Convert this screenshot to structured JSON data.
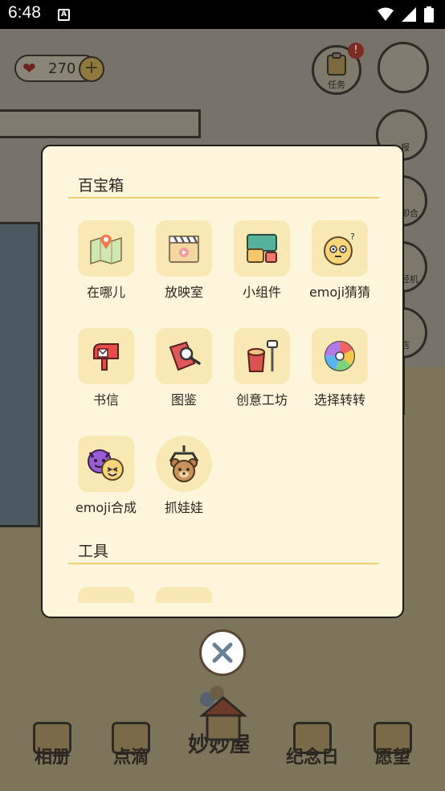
{
  "status": {
    "time": "6:48",
    "sim_label": "A"
  },
  "hud": {
    "hearts": "270",
    "plus": "+",
    "task_label": "任务",
    "task_badge": "!"
  },
  "side_labels": [
    "报",
    "即合",
    "经机",
    "店"
  ],
  "modal": {
    "section1_title": "百宝箱",
    "section2_title": "工具",
    "items": [
      {
        "label": "在哪儿",
        "icon": "map-pin-icon"
      },
      {
        "label": "放映室",
        "icon": "clapperboard-icon"
      },
      {
        "label": "小组件",
        "icon": "widget-icon"
      },
      {
        "label": "emoji猜猜",
        "icon": "emoji-face-icon"
      },
      {
        "label": "书信",
        "icon": "mailbox-icon"
      },
      {
        "label": "图鉴",
        "icon": "book-magnifier-icon"
      },
      {
        "label": "创意工坊",
        "icon": "paint-bucket-icon"
      },
      {
        "label": "选择转转",
        "icon": "color-wheel-icon"
      },
      {
        "label": "emoji合成",
        "icon": "emoji-merge-icon"
      },
      {
        "label": "抓娃娃",
        "icon": "claw-bear-icon"
      }
    ]
  },
  "bottom_nav": {
    "album": "相册",
    "notes": "点滴",
    "home": "妙妙屋",
    "anniversary": "纪念日",
    "wish": "愿望"
  },
  "colors": {
    "modal_bg": "#fdf6dc",
    "tile_bg": "#f8e9b4",
    "divider": "#eecf72",
    "close_border": "#5b4535"
  }
}
